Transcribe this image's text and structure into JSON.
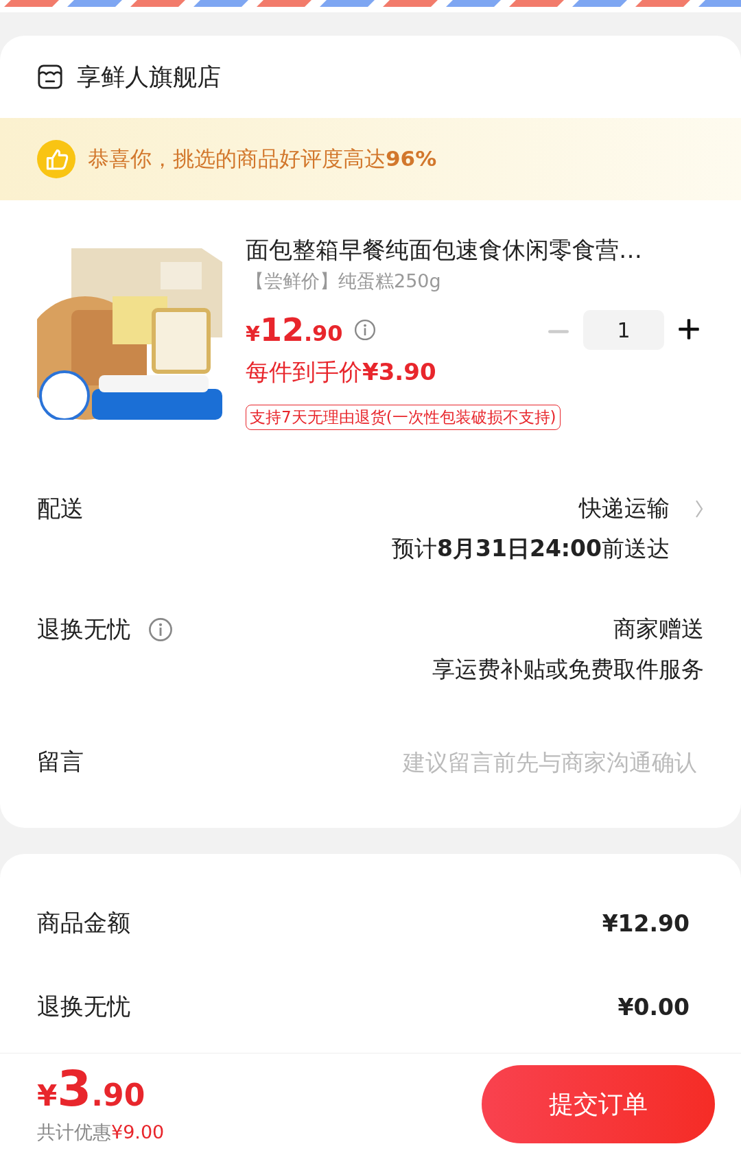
{
  "store": {
    "name": "享鲜人旗舰店"
  },
  "banner": {
    "text": "恭喜你，挑选的商品好评度高达**96%**"
  },
  "product": {
    "kind": "picture",
    "title": "面包整箱早餐纯面包速食休闲零食营…",
    "spec": "【尝鲜价】纯蛋糕250g",
    "price": {
      "symbol": "¥",
      "integer": "12",
      "decimal": ".90"
    },
    "quantity": "1",
    "minus_disabled": true,
    "per_item": "每件到手价**¥3.90**",
    "tag": "支持7天无理由退货(一次性包装破损不支持)"
  },
  "rows": [
    {
      "kind": "delivery",
      "label": "配送",
      "value": "快递运输",
      "detail": "预计**8月31日24:00**前送达"
    },
    {
      "kind": "service",
      "label": "退换无忧",
      "value": "商家赠送",
      "detail": "享运费补贴或免费取件服务"
    },
    {
      "kind": "message",
      "label": "留言",
      "placeholder": "建议留言前先与商家沟通确认"
    }
  ],
  "summary": [
    {
      "label": "商品金额",
      "value": "¥12.90"
    },
    {
      "label": "退换无忧",
      "value": "¥0.00"
    }
  ],
  "footer": {
    "symbol": "¥",
    "integer": "3",
    "decimal": ".90",
    "discount_label": "共计优惠",
    "discount_value": "¥9.00",
    "submit": "提交订单"
  }
}
